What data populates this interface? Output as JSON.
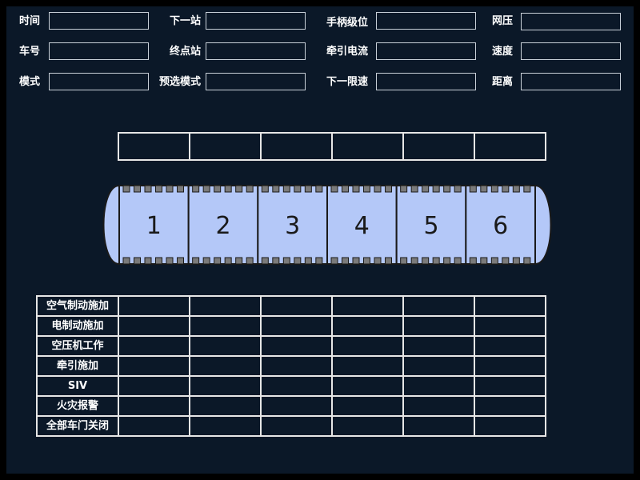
{
  "info_fields": {
    "time_label": "时间",
    "train_number_label": "车号",
    "mode_label": "模式",
    "next_station_label": "下一站",
    "terminal_station_label": "终点站",
    "preselect_mode_label": "预选模式",
    "handle_level_label": "手柄级位",
    "traction_current_label": "牵引电流",
    "next_speed_limit_label": "下一限速",
    "line_voltage_label": "网压",
    "speed_label": "速度",
    "distance_label": "距离",
    "time_value": "",
    "train_number_value": "",
    "mode_value": "",
    "next_station_value": "",
    "terminal_station_value": "",
    "preselect_mode_value": "",
    "handle_level_value": "",
    "traction_current_value": "",
    "next_speed_limit_value": "",
    "line_voltage_value": "",
    "speed_value": "",
    "distance_value": ""
  },
  "train": {
    "cars": [
      "1",
      "2",
      "3",
      "4",
      "5",
      "6"
    ],
    "car_color": "#b4c8f8"
  },
  "status_table": {
    "rows": [
      {
        "label": "空气制动施加"
      },
      {
        "label": "电制动施加"
      },
      {
        "label": "空压机工作"
      },
      {
        "label": "牵引施加"
      },
      {
        "label": "SIV"
      },
      {
        "label": "火灾报警"
      },
      {
        "label": "全部车门关闭"
      }
    ]
  }
}
